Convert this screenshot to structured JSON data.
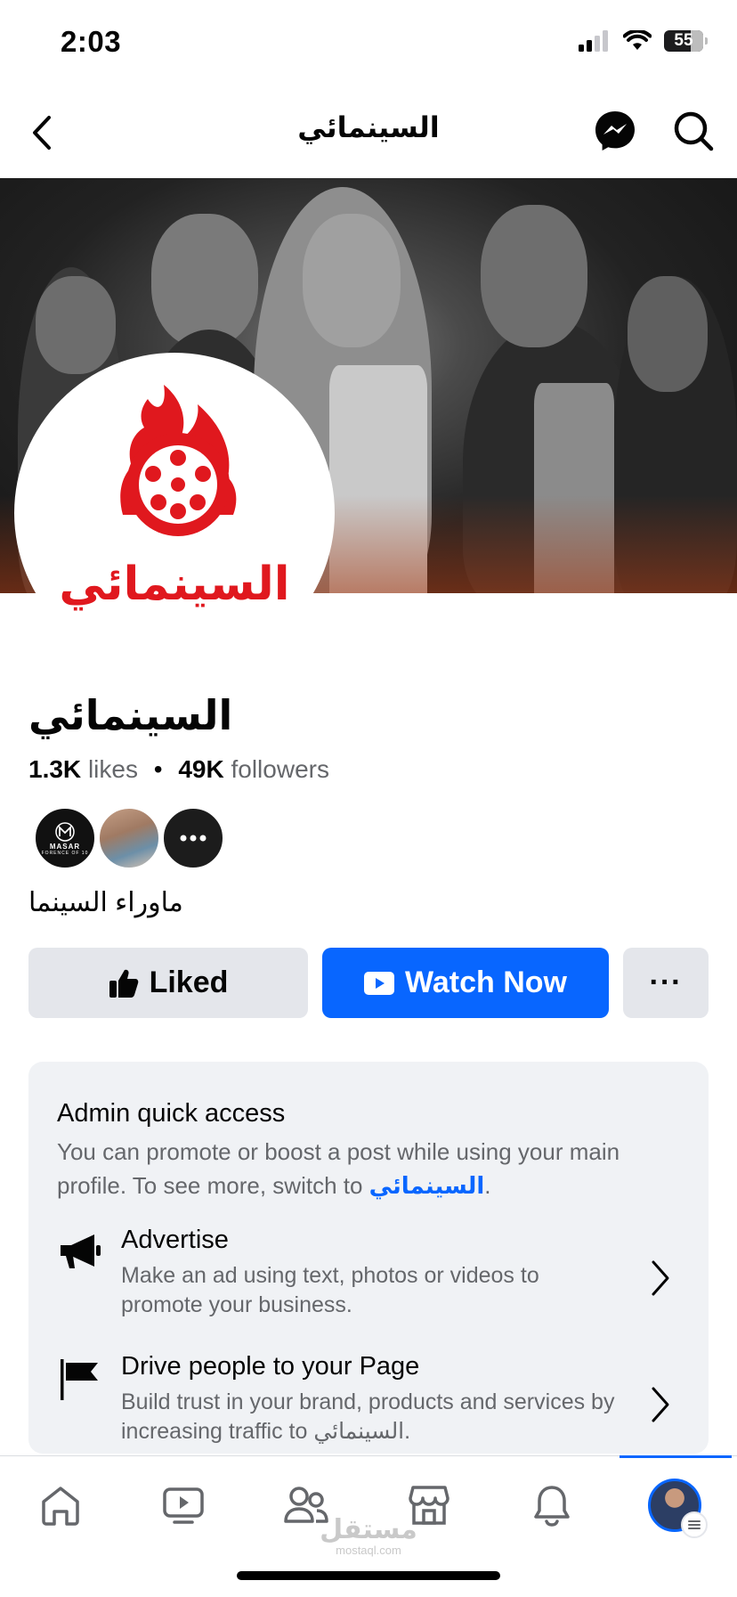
{
  "status": {
    "time": "2:03",
    "battery": "55"
  },
  "nav": {
    "title": "السينمائي",
    "back_icon": "chevron-left-icon",
    "messenger_icon": "messenger-icon",
    "search_icon": "search-icon"
  },
  "profile": {
    "logo_text": "السينمائي",
    "name": "السينمائي",
    "likes_count": "1.3K",
    "likes_label": "likes",
    "separator": "•",
    "followers_count": "49K",
    "followers_label": "followers",
    "friend_avatar_label": "MASAR",
    "friend_avatar_sublabel": "FORENCE OF 10",
    "bio": "ماوراء السينما"
  },
  "actions": {
    "liked_label": "Liked",
    "watch_label": "Watch Now",
    "more_label": "···"
  },
  "admin": {
    "title": "Admin quick access",
    "desc_prefix": "You can promote or boost a post while using your main profile. To see more, switch to ",
    "desc_link": "السينمائي",
    "desc_suffix": ".",
    "items": [
      {
        "title": "Advertise",
        "subtitle": "Make an ad using text, photos or videos to promote your business.",
        "icon": "megaphone-icon"
      },
      {
        "title": "Drive people to your Page",
        "subtitle": "Build trust in your brand, products and services by increasing traffic to السينمائي.",
        "icon": "flag-icon"
      }
    ]
  },
  "watermark": {
    "text": "مستقل",
    "sub": "mostaql.com"
  },
  "colors": {
    "accent": "#0866ff",
    "logo_red": "#e0181e",
    "secondary_bg": "#e4e6eb",
    "card_bg": "#f0f2f5",
    "muted": "#65676b"
  }
}
